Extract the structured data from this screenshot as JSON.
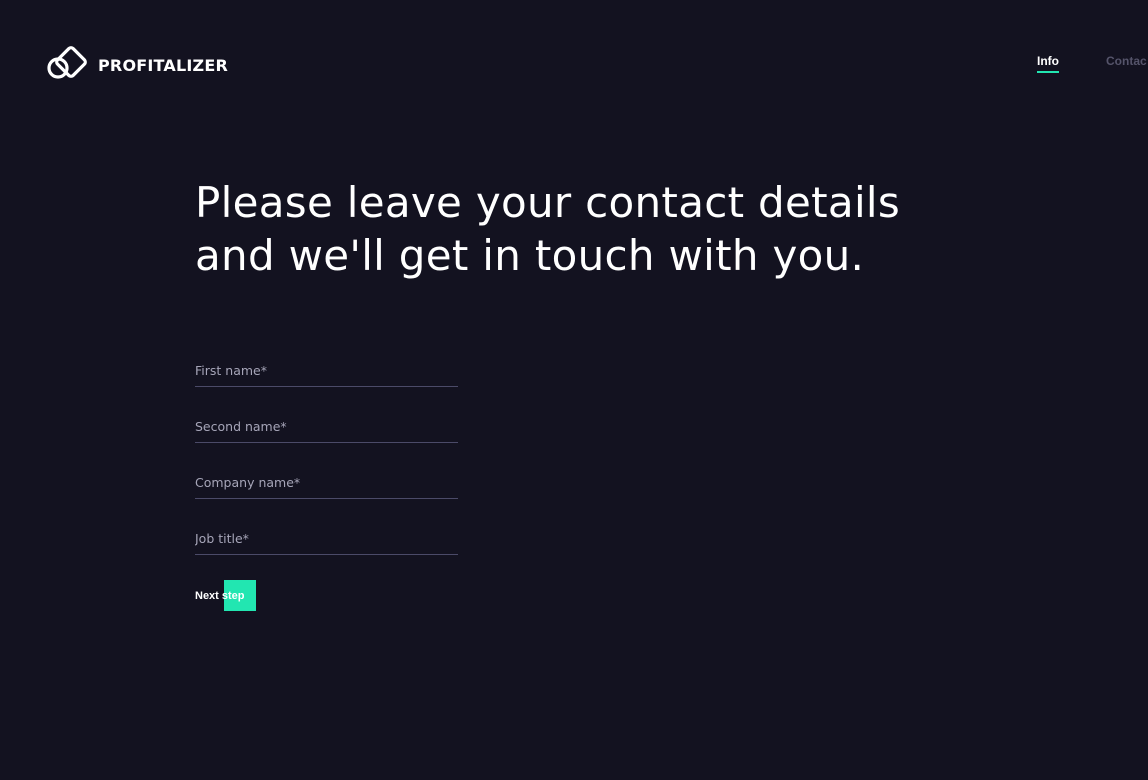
{
  "brand": {
    "name": "PROFITALIZER",
    "icon": "profitalizer-logo-icon"
  },
  "nav": {
    "items": [
      {
        "label": "Info",
        "active": true
      },
      {
        "label": "Contac",
        "active": false
      }
    ]
  },
  "hero": {
    "line1": "Please leave your contact details",
    "line2": "and we'll get in touch with you."
  },
  "form": {
    "first_name": {
      "placeholder": "First name*",
      "value": ""
    },
    "second_name": {
      "placeholder": "Second name*",
      "value": ""
    },
    "company_name": {
      "placeholder": "Company name*",
      "value": ""
    },
    "job_title": {
      "placeholder": "Job title*",
      "value": ""
    },
    "submit_label": "Next step"
  },
  "colors": {
    "background": "#131220",
    "accent": "#22e6b1",
    "text": "#ffffff",
    "muted_text": "#a6a5b8",
    "divider": "#4b4a68",
    "nav_inactive": "#55546a"
  }
}
